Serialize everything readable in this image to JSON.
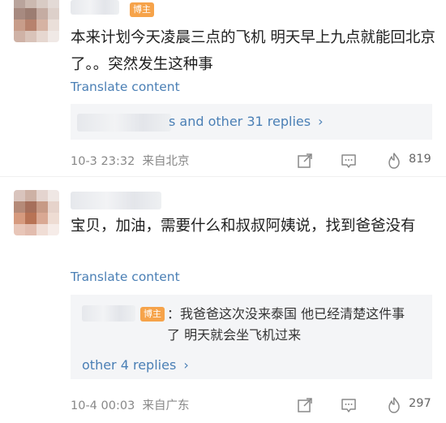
{
  "comments": [
    {
      "badge": "博主",
      "text": "本来计划今天凌晨三点的飞机 明天早上九点就能回北京了。。突然发生这种事",
      "translate": "Translate content",
      "replies_summary": "s and other 31 replies",
      "reply_arrow": "›",
      "time": "10-3 23:32",
      "location": "来自北京",
      "likes": "819"
    },
    {
      "text": "宝贝，加油，需要什么和叔叔阿姨说，找到爸爸没有",
      "translate": "Translate content",
      "reply": {
        "badge": "博主",
        "text": "：我爸爸这次没来泰国 他已经清楚这件事了 明天就会坐飞机过来"
      },
      "more_replies": "other 4 replies",
      "reply_arrow": "›",
      "time": "10-4 00:03",
      "location": "来自广东",
      "likes": "297"
    }
  ],
  "colors": {
    "link": "#4a7fb5",
    "badge": "#f6a34a",
    "reply_bg": "#f4f5f7",
    "meta": "#888888"
  },
  "icons": [
    "share-icon",
    "comment-icon",
    "like-fire-icon"
  ]
}
